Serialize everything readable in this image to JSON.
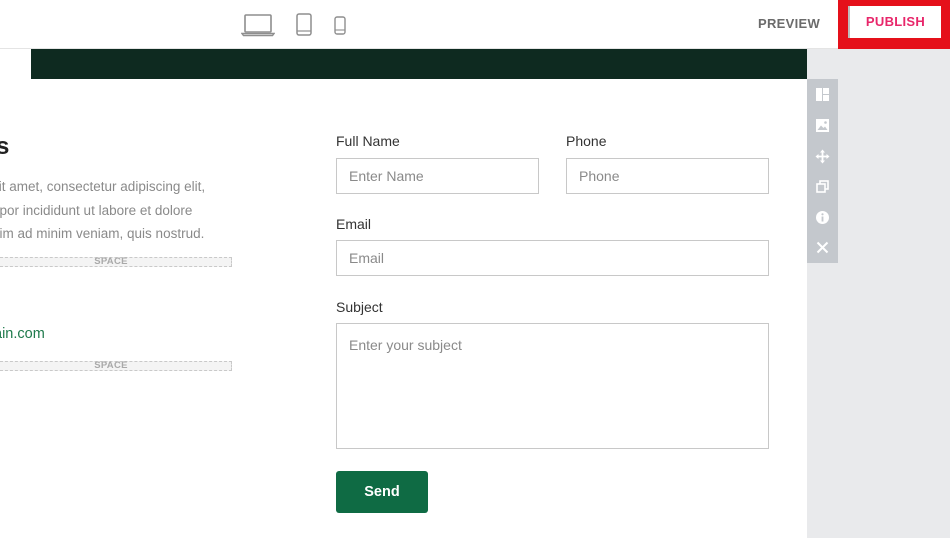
{
  "toolbar": {
    "devices": [
      {
        "name": "desktop",
        "icon": "laptop-icon"
      },
      {
        "name": "tablet",
        "icon": "tablet-icon"
      },
      {
        "name": "mobile",
        "icon": "mobile-icon"
      }
    ],
    "preview_label": "PREVIEW",
    "publish_label": "PUBLISH"
  },
  "content": {
    "heading": "s",
    "paragraph_lines": [
      "sit amet, consectetur adipiscing elit,",
      "npor incididunt ut labore et dolore",
      "nim ad minim veniam, quis nostrud."
    ],
    "space_label": "SPACE",
    "email_text": "ain.com"
  },
  "form": {
    "full_name_label": "Full Name",
    "full_name_placeholder": "Enter Name",
    "phone_label": "Phone",
    "phone_placeholder": "Phone",
    "email_label": "Email",
    "email_placeholder": "Email",
    "subject_label": "Subject",
    "subject_placeholder": "Enter your subject",
    "send_label": "Send"
  },
  "side_tools": [
    "layout-icon",
    "image-icon",
    "move-icon",
    "duplicate-icon",
    "info-icon",
    "close-icon"
  ],
  "colors": {
    "publish_text": "#e8266a",
    "publish_highlight": "#e5101a",
    "banner": "#0e2a20",
    "send_button": "#0f6b44",
    "link": "#1f7a4c"
  }
}
